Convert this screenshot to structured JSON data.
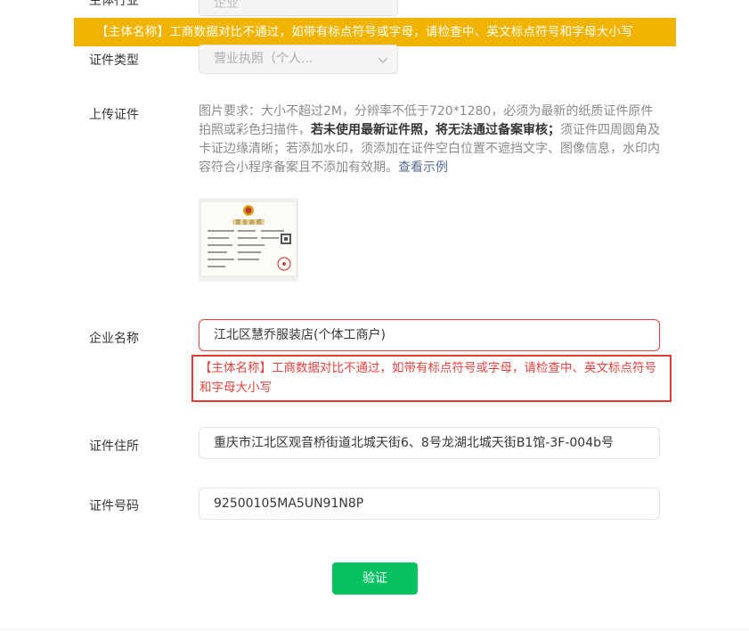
{
  "top_row": {
    "label": "主体行业",
    "value": "企业"
  },
  "banner": {
    "text": "【主体名称】工商数据对比不通过，如带有标点符号或字母，请检查中、英文标点符号和字母大小写"
  },
  "cert_type": {
    "label": "证件类型",
    "value": "营业执照（个人..."
  },
  "upload": {
    "label": "上传证件",
    "req_part1": "图片要求：大小不超过2M，分辨率不低于720*1280，必须为最新的纸质证件原件拍照或彩色扫描件，",
    "req_bold": "若未使用最新证件照，将无法通过备案审核；",
    "req_part2": "须证件四周圆角及卡证边缘清晰；若添加水印，须添加在证件空白位置不遮挡文字、图像信息，水印内容符合小程序备案且不添加有效期。",
    "link": "查看示例",
    "thumb_title": "营 业 执 照"
  },
  "company_name": {
    "label": "企业名称",
    "value": "江北区慧乔服装店(个体工商户)",
    "error": "【主体名称】工商数据对比不通过，如带有标点符号或字母，请检查中、英文标点符号和字母大小写"
  },
  "address": {
    "label": "证件住所",
    "value": "重庆市江北区观音桥街道北城天街6、8号龙湖北城天街B1馆-3F-004b号"
  },
  "cert_number": {
    "label": "证件号码",
    "value": "92500105MA5UN91N8P"
  },
  "verify_button": {
    "label": "验证"
  },
  "colors": {
    "banner": "#f0b400",
    "error": "#e64340",
    "primary": "#07c160",
    "link": "#576b95"
  }
}
